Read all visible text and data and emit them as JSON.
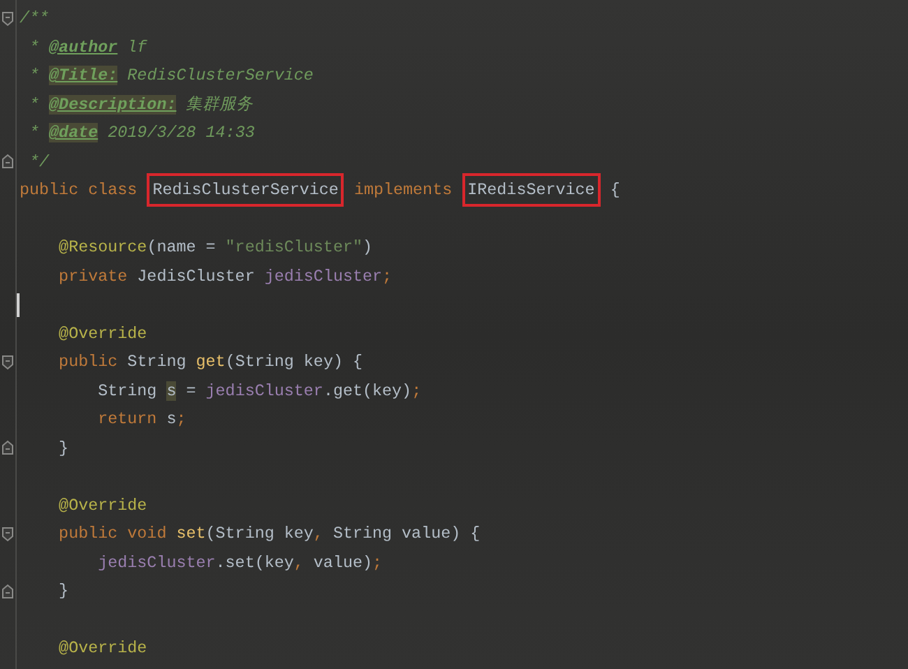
{
  "editor": {
    "lines": [
      {
        "fold_start": true,
        "fold_end": false,
        "caret": false,
        "tokens": [
          {
            "text": "/**",
            "kind": "comment"
          }
        ]
      },
      {
        "fold_start": false,
        "fold_end": false,
        "caret": false,
        "tokens": [
          {
            "text": " * ",
            "kind": "comment"
          },
          {
            "text": "@author",
            "kind": "doctag",
            "highlighted": false
          },
          {
            "text": " lf",
            "kind": "comment"
          }
        ]
      },
      {
        "fold_start": false,
        "fold_end": false,
        "caret": false,
        "tokens": [
          {
            "text": " * ",
            "kind": "comment"
          },
          {
            "text": "@Title:",
            "kind": "doctag",
            "highlighted": true
          },
          {
            "text": " RedisClusterService",
            "kind": "comment"
          }
        ]
      },
      {
        "fold_start": false,
        "fold_end": false,
        "caret": false,
        "tokens": [
          {
            "text": " * ",
            "kind": "comment"
          },
          {
            "text": "@Description:",
            "kind": "doctag",
            "highlighted": true
          },
          {
            "text": " 集群服务",
            "kind": "comment"
          }
        ]
      },
      {
        "fold_start": false,
        "fold_end": false,
        "caret": false,
        "tokens": [
          {
            "text": " * ",
            "kind": "comment"
          },
          {
            "text": "@date",
            "kind": "doctag",
            "highlighted": true
          },
          {
            "text": " 2019/3/28 14:33",
            "kind": "comment"
          }
        ]
      },
      {
        "fold_start": false,
        "fold_end": true,
        "caret": false,
        "tokens": [
          {
            "text": " */",
            "kind": "comment"
          }
        ]
      },
      {
        "fold_start": false,
        "fold_end": false,
        "caret": false,
        "tokens": [
          {
            "text": "public class ",
            "kind": "keyword"
          },
          {
            "text": "RedisClusterService",
            "kind": "plain",
            "boxed": true
          },
          {
            "text": " implements ",
            "kind": "keyword"
          },
          {
            "text": "IRedisService",
            "kind": "plain",
            "boxed": true
          },
          {
            "text": " {",
            "kind": "plain"
          }
        ]
      },
      {
        "fold_start": false,
        "fold_end": false,
        "caret": false
      },
      {
        "fold_start": false,
        "fold_end": false,
        "caret": false,
        "tokens": [
          {
            "text": "    @Resource",
            "kind": "annotation"
          },
          {
            "text": "(name = ",
            "kind": "plain"
          },
          {
            "text": "\"redisCluster\"",
            "kind": "string"
          },
          {
            "text": ")",
            "kind": "plain"
          }
        ]
      },
      {
        "fold_start": false,
        "fold_end": false,
        "caret": false,
        "tokens": [
          {
            "text": "    private ",
            "kind": "keyword"
          },
          {
            "text": "JedisCluster ",
            "kind": "plain"
          },
          {
            "text": "jedisCluster",
            "kind": "field"
          },
          {
            "text": ";",
            "kind": "keyword"
          }
        ]
      },
      {
        "fold_start": false,
        "fold_end": false,
        "caret": true
      },
      {
        "fold_start": false,
        "fold_end": false,
        "caret": false,
        "tokens": [
          {
            "text": "    @Override",
            "kind": "annotation"
          }
        ]
      },
      {
        "fold_start": true,
        "fold_end": false,
        "caret": false,
        "tokens": [
          {
            "text": "    public ",
            "kind": "keyword"
          },
          {
            "text": "String ",
            "kind": "plain"
          },
          {
            "text": "get",
            "kind": "method"
          },
          {
            "text": "(String key) {",
            "kind": "plain"
          }
        ]
      },
      {
        "fold_start": false,
        "fold_end": false,
        "caret": false,
        "tokens": [
          {
            "text": "        String ",
            "kind": "plain"
          },
          {
            "text": "s",
            "kind": "plain",
            "highlighted": true
          },
          {
            "text": " = ",
            "kind": "plain"
          },
          {
            "text": "jedisCluster",
            "kind": "field"
          },
          {
            "text": ".get(key)",
            "kind": "plain"
          },
          {
            "text": ";",
            "kind": "keyword"
          }
        ]
      },
      {
        "fold_start": false,
        "fold_end": false,
        "caret": false,
        "tokens": [
          {
            "text": "        return ",
            "kind": "keyword"
          },
          {
            "text": "s",
            "kind": "plain"
          },
          {
            "text": ";",
            "kind": "keyword"
          }
        ]
      },
      {
        "fold_start": false,
        "fold_end": true,
        "caret": false,
        "tokens": [
          {
            "text": "    }",
            "kind": "plain"
          }
        ]
      },
      {
        "fold_start": false,
        "fold_end": false,
        "caret": false
      },
      {
        "fold_start": false,
        "fold_end": false,
        "caret": false,
        "tokens": [
          {
            "text": "    @Override",
            "kind": "annotation"
          }
        ]
      },
      {
        "fold_start": true,
        "fold_end": false,
        "caret": false,
        "tokens": [
          {
            "text": "    public void ",
            "kind": "keyword"
          },
          {
            "text": "set",
            "kind": "method"
          },
          {
            "text": "(String key",
            "kind": "plain"
          },
          {
            "text": ", ",
            "kind": "keyword"
          },
          {
            "text": "String value) {",
            "kind": "plain"
          }
        ]
      },
      {
        "fold_start": false,
        "fold_end": false,
        "caret": false,
        "tokens": [
          {
            "text": "        jedisCluster",
            "kind": "field"
          },
          {
            "text": ".set(key",
            "kind": "plain"
          },
          {
            "text": ", ",
            "kind": "keyword"
          },
          {
            "text": "value)",
            "kind": "plain"
          },
          {
            "text": ";",
            "kind": "keyword"
          }
        ]
      },
      {
        "fold_start": false,
        "fold_end": true,
        "caret": false,
        "tokens": [
          {
            "text": "    }",
            "kind": "plain"
          }
        ]
      },
      {
        "fold_start": false,
        "fold_end": false,
        "caret": false
      },
      {
        "fold_start": false,
        "fold_end": false,
        "caret": false,
        "tokens": [
          {
            "text": "    @Override",
            "kind": "annotation"
          }
        ]
      }
    ]
  }
}
